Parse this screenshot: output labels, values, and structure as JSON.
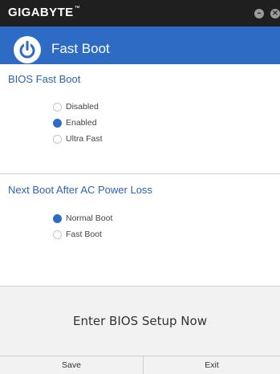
{
  "app": {
    "brand": "GIGABYTE",
    "brand_mark": "™"
  },
  "header": {
    "title": "Fast Boot",
    "icon": "power-icon"
  },
  "bios_fast_boot": {
    "title": "BIOS Fast Boot",
    "options": [
      {
        "label": "Disabled",
        "selected": false
      },
      {
        "label": "Enabled",
        "selected": true
      },
      {
        "label": "Ultra Fast",
        "selected": false
      }
    ]
  },
  "next_boot": {
    "title": "Next Boot After AC Power Loss",
    "options": [
      {
        "label": "Normal Boot",
        "selected": true
      },
      {
        "label": "Fast Boot",
        "selected": false
      }
    ]
  },
  "actions": {
    "enter_bios": "Enter BIOS Setup Now",
    "save": "Save",
    "exit": "Exit"
  },
  "colors": {
    "accent": "#2d6bc4",
    "titlebar": "#1f1f1f"
  }
}
